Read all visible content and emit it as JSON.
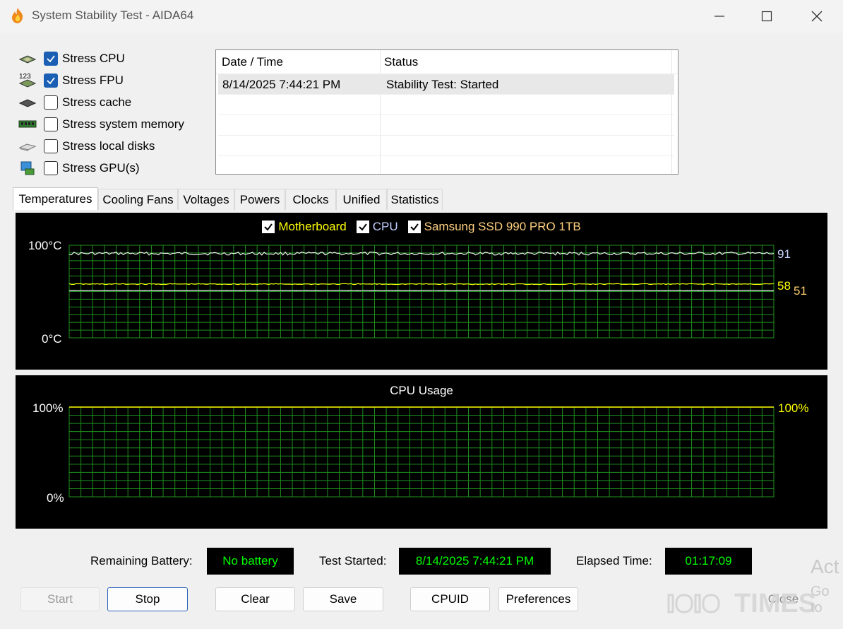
{
  "window": {
    "title": "System Stability Test - AIDA64"
  },
  "stress_options": [
    {
      "label": "Stress CPU",
      "checked": true,
      "icon": "cpu-chip-icon"
    },
    {
      "label": "Stress FPU",
      "checked": true,
      "icon": "fpu-chip-icon"
    },
    {
      "label": "Stress cache",
      "checked": false,
      "icon": "cache-chip-icon"
    },
    {
      "label": "Stress system memory",
      "checked": false,
      "icon": "memory-module-icon"
    },
    {
      "label": "Stress local disks",
      "checked": false,
      "icon": "hard-disk-icon"
    },
    {
      "label": "Stress GPU(s)",
      "checked": false,
      "icon": "gpu-monitor-icon"
    }
  ],
  "fpu_icon_text": "123",
  "log": {
    "columns": [
      "Date / Time",
      "Status"
    ],
    "rows": [
      {
        "datetime": "8/14/2025 7:44:21 PM",
        "status": "Stability Test: Started"
      }
    ]
  },
  "tabs": [
    "Temperatures",
    "Cooling Fans",
    "Voltages",
    "Powers",
    "Clocks",
    "Unified",
    "Statistics"
  ],
  "active_tab": "Temperatures",
  "temperature_chart": {
    "legend": [
      {
        "label": "Motherboard",
        "checked": true,
        "color": "#ffff00"
      },
      {
        "label": "CPU",
        "checked": true,
        "color": "#c0d0ff"
      },
      {
        "label": "Samsung SSD 990 PRO 1TB",
        "checked": true,
        "color": "#ffd080"
      }
    ],
    "y_max_label": "100°C",
    "y_min_label": "0°C",
    "current_values": [
      {
        "value": "91",
        "color": "#c8d2ff"
      },
      {
        "value": "58",
        "color": "#ffff00"
      },
      {
        "value": "51",
        "color": "#ffd070"
      }
    ]
  },
  "cpu_usage_chart": {
    "title": "CPU Usage",
    "y_max_label": "100%",
    "y_min_label": "0%",
    "current_value": "100%",
    "current_color": "#ffff00"
  },
  "chart_data": [
    {
      "type": "line",
      "y_unit": "°C",
      "ylim": [
        0,
        100
      ],
      "grid": true,
      "legend_position": "top-center",
      "series": [
        {
          "name": "CPU",
          "color": "#ffffff",
          "level": 91
        },
        {
          "name": "Motherboard",
          "color": "#ffff00",
          "level": 58
        },
        {
          "name": "Samsung SSD 990 PRO 1TB",
          "color": "#ffffff",
          "level": 51
        }
      ]
    },
    {
      "type": "line",
      "title": "CPU Usage",
      "y_unit": "%",
      "ylim": [
        0,
        100
      ],
      "grid": true,
      "series": [
        {
          "name": "CPU Usage",
          "color": "#ffff00",
          "level": 100
        }
      ]
    }
  ],
  "status": {
    "battery_label": "Remaining Battery:",
    "battery_value": "No battery",
    "started_label": "Test Started:",
    "started_value": "8/14/2025 7:44:21 PM",
    "elapsed_label": "Elapsed Time:",
    "elapsed_value": "01:17:09",
    "value_color": "#00ff00"
  },
  "buttons": {
    "start": "Start",
    "stop": "Stop",
    "clear": "Clear",
    "save": "Save",
    "cpuid": "CPUID",
    "preferences": "Preferences",
    "close": "Close"
  },
  "watermark": {
    "logo_text": "TIMES",
    "activate_text": "Act",
    "goto_text": "Go to"
  }
}
